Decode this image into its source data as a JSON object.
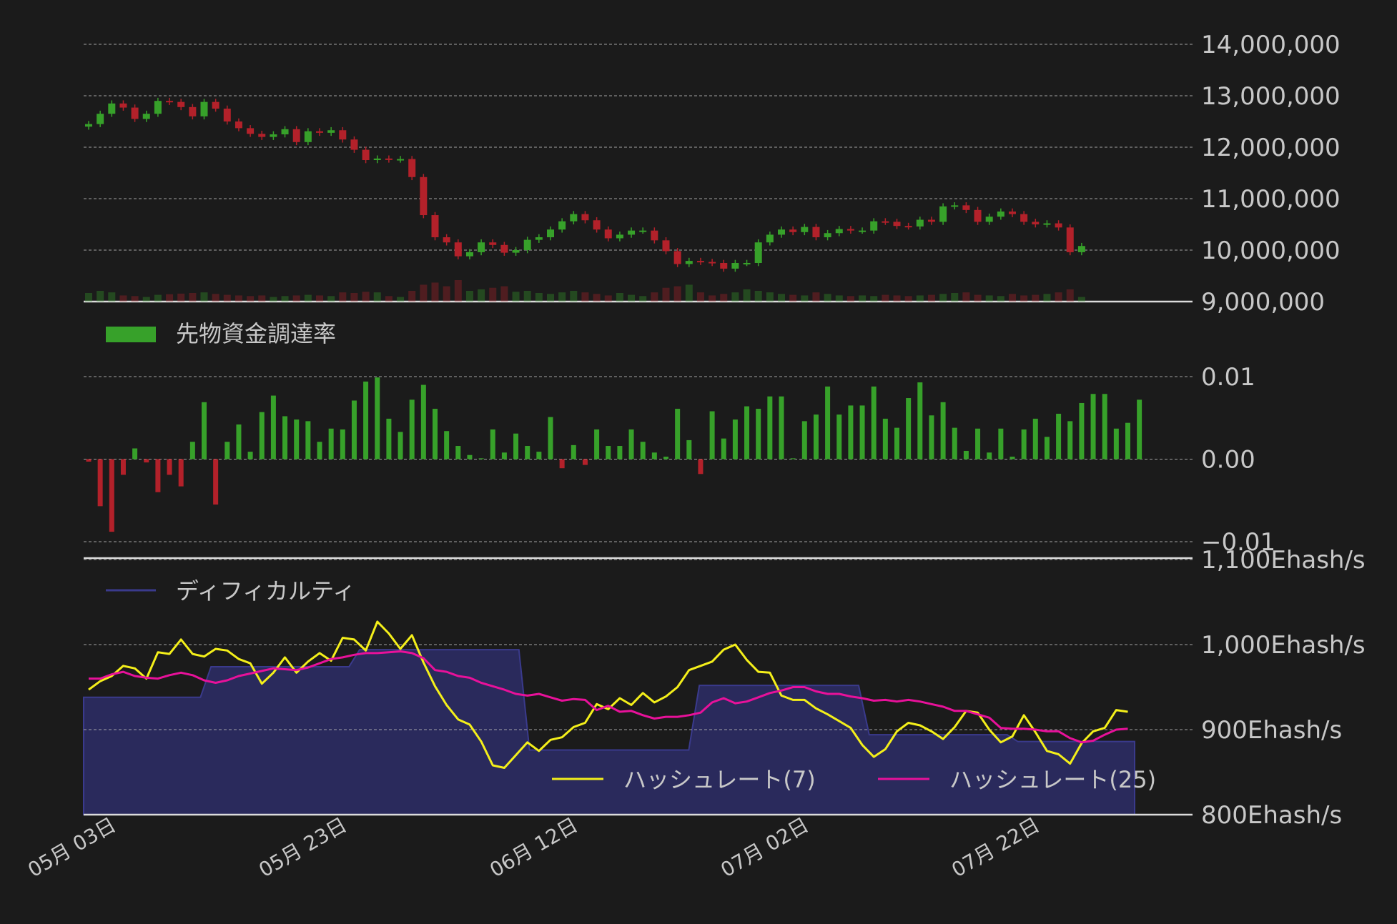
{
  "colors": {
    "background": "#1b1b1b",
    "up": "#37a12a",
    "down": "#b3212a",
    "grid": "#bbbbbb",
    "axis_text": "#c8c8c8",
    "difficulty_fill": "#2a2a5c",
    "difficulty_line": "#3a3a8c",
    "hash7": "#f4ef1a",
    "hash25": "#e8119a",
    "separator": "#dcdcdc"
  },
  "chart_data": [
    {
      "type": "candlestick",
      "ylim": [
        9000000,
        14000000
      ],
      "yticks": [
        "14,000,000",
        "13,000,000",
        "12,000,000",
        "11,000,000",
        "10,000,000",
        "9,000,000"
      ],
      "ytick_values": [
        14000000,
        13000000,
        12000000,
        11000000,
        10000000,
        9000000
      ],
      "x": [
        "05-01",
        "05-02",
        "05-03",
        "05-04",
        "05-05",
        "05-06",
        "05-07",
        "05-08",
        "05-09",
        "05-10",
        "05-11",
        "05-12",
        "05-13",
        "05-14",
        "05-15",
        "05-16",
        "05-17",
        "05-18",
        "05-19",
        "05-20",
        "05-21",
        "05-22",
        "05-23",
        "05-24",
        "05-25",
        "05-26",
        "05-27",
        "05-28",
        "05-29",
        "05-30",
        "05-31",
        "06-01",
        "06-02",
        "06-03",
        "06-04",
        "06-05",
        "06-06",
        "06-07",
        "06-08",
        "06-09",
        "06-10",
        "06-11",
        "06-12",
        "06-13",
        "06-14",
        "06-15",
        "06-16",
        "06-17",
        "06-18",
        "06-19",
        "06-20",
        "06-21",
        "06-22",
        "06-23",
        "06-24",
        "06-25",
        "06-26",
        "06-27",
        "06-28",
        "06-29",
        "06-30",
        "07-01",
        "07-02",
        "07-03",
        "07-04",
        "07-05",
        "07-06",
        "07-07",
        "07-08",
        "07-09",
        "07-10",
        "07-11",
        "07-12",
        "07-13",
        "07-14",
        "07-15",
        "07-16",
        "07-17",
        "07-18",
        "07-19",
        "07-20",
        "07-21",
        "07-22",
        "07-23",
        "07-24",
        "07-25",
        "07-26",
        "07-27",
        "07-28",
        "07-29",
        "07-30",
        "07-31"
      ],
      "open": [
        12400000,
        12450000,
        12650000,
        12850000,
        12770000,
        12550000,
        12650000,
        12900000,
        12880000,
        12780000,
        12600000,
        12880000,
        12750000,
        12500000,
        12370000,
        12260000,
        12200000,
        12250000,
        12350000,
        12100000,
        12310000,
        12280000,
        12330000,
        12150000,
        11950000,
        11750000,
        11780000,
        11760000,
        11770000,
        11420000,
        10680000,
        10250000,
        10150000,
        9880000,
        9960000,
        10150000,
        10100000,
        9950000,
        10000000,
        10200000,
        10250000,
        10400000,
        10560000,
        10700000,
        10580000,
        10400000,
        10230000,
        10300000,
        10380000,
        10380000,
        10190000,
        9980000,
        9730000,
        9790000,
        9770000,
        9750000,
        9640000,
        9750000,
        9750000,
        10150000,
        10300000,
        10400000,
        10350000,
        10450000,
        10250000,
        10330000,
        10410000,
        10380000,
        10380000,
        10560000,
        10550000,
        10470000,
        10460000,
        10590000,
        10550000,
        10850000,
        10870000,
        10780000,
        10550000,
        10650000,
        10750000,
        10700000,
        10550000,
        10500000,
        10520000,
        10440000,
        9960000
      ],
      "close": [
        12450000,
        12650000,
        12850000,
        12770000,
        12550000,
        12650000,
        12900000,
        12880000,
        12780000,
        12600000,
        12880000,
        12750000,
        12500000,
        12370000,
        12260000,
        12200000,
        12250000,
        12350000,
        12100000,
        12310000,
        12280000,
        12330000,
        12150000,
        11950000,
        11750000,
        11780000,
        11760000,
        11770000,
        11420000,
        10680000,
        10250000,
        10150000,
        9880000,
        9960000,
        10150000,
        10100000,
        9950000,
        10000000,
        10200000,
        10250000,
        10400000,
        10560000,
        10700000,
        10580000,
        10400000,
        10230000,
        10300000,
        10380000,
        10380000,
        10190000,
        9980000,
        9730000,
        9790000,
        9770000,
        9750000,
        9640000,
        9750000,
        9750000,
        10150000,
        10300000,
        10400000,
        10350000,
        10450000,
        10250000,
        10330000,
        10410000,
        10380000,
        10380000,
        10560000,
        10550000,
        10470000,
        10460000,
        10590000,
        10550000,
        10850000,
        10870000,
        10780000,
        10550000,
        10650000,
        10750000,
        10700000,
        10550000,
        10500000,
        10520000,
        10440000,
        9960000,
        10080000
      ],
      "volume": [
        0.28,
        0.35,
        0.3,
        0.2,
        0.18,
        0.15,
        0.22,
        0.24,
        0.26,
        0.28,
        0.3,
        0.25,
        0.22,
        0.2,
        0.18,
        0.2,
        0.15,
        0.18,
        0.2,
        0.22,
        0.2,
        0.18,
        0.3,
        0.28,
        0.32,
        0.3,
        0.18,
        0.15,
        0.35,
        0.55,
        0.62,
        0.5,
        0.7,
        0.35,
        0.4,
        0.45,
        0.5,
        0.32,
        0.35,
        0.28,
        0.25,
        0.3,
        0.35,
        0.3,
        0.25,
        0.2,
        0.28,
        0.22,
        0.18,
        0.3,
        0.45,
        0.5,
        0.55,
        0.3,
        0.2,
        0.25,
        0.3,
        0.4,
        0.35,
        0.3,
        0.25,
        0.22,
        0.2,
        0.3,
        0.25,
        0.2,
        0.18,
        0.2,
        0.18,
        0.22,
        0.2,
        0.18,
        0.2,
        0.22,
        0.25,
        0.28,
        0.3,
        0.22,
        0.2,
        0.18,
        0.25,
        0.2,
        0.22,
        0.25,
        0.3,
        0.4,
        0.15
      ]
    },
    {
      "type": "bar",
      "legend": "先物資金調達率",
      "ylim": [
        -0.01,
        0.01
      ],
      "yticks": [
        "0.01",
        "0.00",
        "−0.01"
      ],
      "ytick_values": [
        0.01,
        0.0,
        -0.01
      ],
      "values": [
        -0.0003,
        -0.0057,
        -0.0088,
        -0.0019,
        0.0013,
        -0.0004,
        -0.004,
        -0.0019,
        -0.0033,
        0.0021,
        0.0069,
        -0.0055,
        0.0021,
        0.0042,
        0.0009,
        0.0057,
        0.0077,
        0.0052,
        0.0048,
        0.0046,
        0.0021,
        0.0037,
        0.0036,
        0.0071,
        0.0094,
        0.0099,
        0.0049,
        0.0033,
        0.0072,
        0.009,
        0.0061,
        0.0034,
        0.0016,
        0.0005,
        0.0001,
        0.0036,
        0.0008,
        0.0031,
        0.0016,
        0.0009,
        0.0051,
        -0.0011,
        0.0017,
        -0.0007,
        0.0036,
        0.0016,
        0.0016,
        0.0036,
        0.0021,
        0.0008,
        0.0003,
        0.0061,
        0.0023,
        -0.0018,
        0.0058,
        0.0025,
        0.0048,
        0.0064,
        0.0061,
        0.0076,
        0.0076,
        0.0001,
        0.0046,
        0.0054,
        0.0088,
        0.0054,
        0.0065,
        0.0065,
        0.0088,
        0.0049,
        0.0038,
        0.0074,
        0.0093,
        0.0053,
        0.0069,
        0.0038,
        0.001,
        0.0037,
        0.0008,
        0.0037,
        0.0003,
        0.0036,
        0.0049,
        0.0027,
        0.0055,
        0.0046,
        0.0068,
        0.0079,
        0.0079,
        0.0037,
        0.0044,
        0.0072
      ]
    },
    {
      "type": "line",
      "ylim": [
        800,
        1100
      ],
      "yticks": [
        "1,100Ehash/s",
        "1,000Ehash/s",
        "900Ehash/s",
        "800Ehash/s"
      ],
      "ytick_values": [
        1100,
        1000,
        900,
        800
      ],
      "xtick_labels": [
        {
          "index": 2,
          "label": "05月 03日"
        },
        {
          "index": 22,
          "label": "05月 23日"
        },
        {
          "index": 42,
          "label": "06月 12日"
        },
        {
          "index": 62,
          "label": "07月 02日"
        },
        {
          "index": 82,
          "label": "07月 22日"
        }
      ],
      "area_legend": "ディフィカルティ",
      "series": [
        {
          "name": "ハッシュレート(7)",
          "values": [
            947,
            957,
            963,
            975,
            972,
            960,
            991,
            989,
            1006,
            989,
            986,
            995,
            993,
            983,
            978,
            954,
            967,
            985,
            967,
            980,
            990,
            981,
            1008,
            1006,
            993,
            1027,
            1013,
            995,
            1011,
            979,
            951,
            929,
            912,
            906,
            886,
            858,
            855,
            870,
            885,
            875,
            888,
            891,
            903,
            908,
            930,
            924,
            937,
            929,
            943,
            932,
            939,
            950,
            970,
            975,
            980,
            994,
            1000,
            982,
            968,
            967,
            940,
            935,
            935,
            925,
            918,
            910,
            902,
            882,
            868,
            877,
            898,
            908,
            905,
            898,
            889,
            903,
            922,
            920,
            900,
            885,
            892,
            917,
            897,
            875,
            871,
            860,
            884,
            898,
            902,
            923,
            921
          ]
        },
        {
          "name": "ハッシュレート(25)",
          "values": [
            960,
            960,
            965,
            968,
            963,
            961,
            960,
            964,
            967,
            964,
            958,
            955,
            958,
            963,
            966,
            969,
            972,
            971,
            970,
            973,
            978,
            983,
            985,
            988,
            990,
            990,
            991,
            992,
            990,
            984,
            970,
            968,
            963,
            961,
            955,
            951,
            947,
            942,
            940,
            942,
            938,
            934,
            936,
            935,
            923,
            928,
            921,
            922,
            917,
            913,
            915,
            915,
            917,
            920,
            932,
            937,
            931,
            933,
            938,
            943,
            946,
            950,
            950,
            945,
            942,
            942,
            939,
            937,
            934,
            935,
            933,
            935,
            933,
            930,
            927,
            922,
            922,
            918,
            914,
            902,
            901,
            901,
            900,
            898,
            898,
            890,
            885,
            887,
            894,
            900,
            901
          ]
        },
        {
          "name": "ディフィカルティ",
          "type": "area",
          "values": [
            938,
            938,
            938,
            938,
            938,
            938,
            938,
            938,
            938,
            938,
            938,
            938,
            974,
            974,
            974,
            974,
            974,
            974,
            974,
            974,
            974,
            974,
            974,
            974,
            974,
            974,
            994,
            994,
            994,
            994,
            994,
            994,
            994,
            994,
            994,
            994,
            994,
            994,
            994,
            994,
            994,
            994,
            876,
            876,
            876,
            876,
            876,
            876,
            876,
            876,
            876,
            876,
            876,
            876,
            876,
            876,
            876,
            876,
            952,
            952,
            952,
            952,
            952,
            952,
            952,
            952,
            952,
            952,
            952,
            952,
            952,
            952,
            952,
            952,
            894,
            894,
            894,
            894,
            894,
            894,
            894,
            894,
            894,
            894,
            894,
            894,
            894,
            894,
            886,
            886,
            886,
            886,
            886,
            886,
            886,
            886,
            886,
            886,
            886,
            886
          ]
        }
      ]
    }
  ]
}
